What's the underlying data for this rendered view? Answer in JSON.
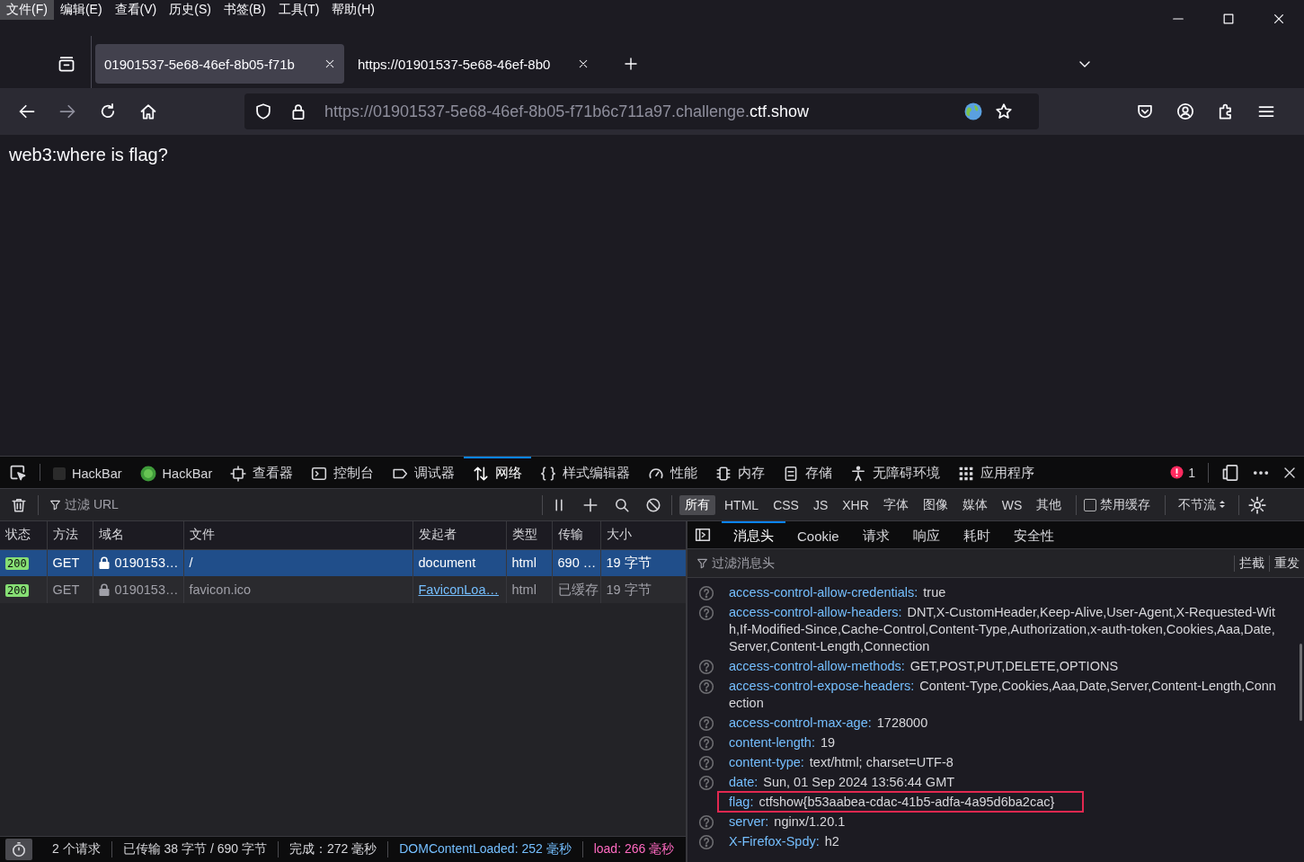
{
  "menu_bar": [
    {
      "label": "文件(F)",
      "selected": true
    },
    {
      "label": "编辑(E)",
      "selected": false
    },
    {
      "label": "查看(V)",
      "selected": false
    },
    {
      "label": "历史(S)",
      "selected": false
    },
    {
      "label": "书签(B)",
      "selected": false
    },
    {
      "label": "工具(T)",
      "selected": false
    },
    {
      "label": "帮助(H)",
      "selected": false
    }
  ],
  "tabs": [
    {
      "title": "01901537-5e68-46ef-8b05-f71b",
      "selected": true
    },
    {
      "title": "https://01901537-5e68-46ef-8b0",
      "selected": false
    }
  ],
  "address_bar": {
    "url_prefix": "https://01901537-5e68-46ef-8b05-f71b6c711a97.challenge.",
    "url_domain": "ctf.show"
  },
  "page": {
    "text": "web3:where is flag?"
  },
  "devtools": {
    "tools": [
      {
        "label": "HackBar",
        "selected": false
      },
      {
        "label": "HackBar",
        "selected": false
      },
      {
        "label": "查看器",
        "selected": false
      },
      {
        "label": "控制台",
        "selected": false
      },
      {
        "label": "调试器",
        "selected": false
      },
      {
        "label": "网络",
        "selected": true
      },
      {
        "label": "样式编辑器",
        "selected": false
      },
      {
        "label": "性能",
        "selected": false
      },
      {
        "label": "内存",
        "selected": false
      },
      {
        "label": "存储",
        "selected": false
      },
      {
        "label": "无障碍环境",
        "selected": false
      },
      {
        "label": "应用程序",
        "selected": false
      }
    ],
    "error_count": "1",
    "filter_placeholder": "过滤 URL",
    "type_filters": [
      {
        "label": "所有",
        "selected": true
      },
      {
        "label": "HTML",
        "selected": false
      },
      {
        "label": "CSS",
        "selected": false
      },
      {
        "label": "JS",
        "selected": false
      },
      {
        "label": "XHR",
        "selected": false
      },
      {
        "label": "字体",
        "selected": false
      },
      {
        "label": "图像",
        "selected": false
      },
      {
        "label": "媒体",
        "selected": false
      },
      {
        "label": "WS",
        "selected": false
      },
      {
        "label": "其他",
        "selected": false
      }
    ],
    "disable_cache": {
      "label": "禁用缓存",
      "checked": false
    },
    "throttle": "不节流",
    "table": {
      "columns": [
        "状态",
        "方法",
        "域名",
        "文件",
        "发起者",
        "类型",
        "传输",
        "大小"
      ],
      "rows": [
        {
          "status": "200",
          "method": "GET",
          "domain": "0190153…",
          "file": "/",
          "initiator": "document",
          "initiator_link": false,
          "type": "html",
          "transferred": "690 …",
          "size": "19 字节",
          "selected": true,
          "cached": false
        },
        {
          "status": "200",
          "method": "GET",
          "domain": "0190153…",
          "file": "favicon.ico",
          "initiator": "FaviconLoa…",
          "initiator_link": true,
          "type": "html",
          "transferred": "已缓存",
          "size": "19 字节",
          "selected": false,
          "cached": true
        }
      ]
    },
    "detail_tabs": [
      {
        "label": "消息头",
        "selected": true
      },
      {
        "label": "Cookie",
        "selected": false
      },
      {
        "label": "请求",
        "selected": false
      },
      {
        "label": "响应",
        "selected": false
      },
      {
        "label": "耗时",
        "selected": false
      },
      {
        "label": "安全性",
        "selected": false
      }
    ],
    "headers_filter_placeholder": "过滤消息头",
    "header_actions": [
      "拦截",
      "重发"
    ],
    "headers": [
      {
        "name": "access-control-allow-credentials:",
        "value": "true",
        "info_icon": true,
        "highlighted": false
      },
      {
        "name": "access-control-allow-headers:",
        "value": "DNT,X-CustomHeader,Keep-Alive,User-Agent,X-Requested-With,If-Modified-Since,Cache-Control,Content-Type,Authorization,x-auth-token,Cookies,Aaa,Date,Server,Content-Length,Connection",
        "info_icon": true,
        "highlighted": false
      },
      {
        "name": "access-control-allow-methods:",
        "value": "GET,POST,PUT,DELETE,OPTIONS",
        "info_icon": true,
        "highlighted": false
      },
      {
        "name": "access-control-expose-headers:",
        "value": "Content-Type,Cookies,Aaa,Date,Server,Content-Length,Connection",
        "info_icon": true,
        "highlighted": false
      },
      {
        "name": "access-control-max-age:",
        "value": "1728000",
        "info_icon": true,
        "highlighted": false
      },
      {
        "name": "content-length:",
        "value": "19",
        "info_icon": true,
        "highlighted": false
      },
      {
        "name": "content-type:",
        "value": "text/html; charset=UTF-8",
        "info_icon": true,
        "highlighted": false
      },
      {
        "name": "date:",
        "value": "Sun, 01 Sep 2024 13:56:44 GMT",
        "info_icon": true,
        "highlighted": false
      },
      {
        "name": "flag:",
        "value": "ctfshow{b53aabea-cdac-41b5-adfa-4a95d6ba2cac}",
        "info_icon": false,
        "highlighted": true
      },
      {
        "name": "server:",
        "value": "nginx/1.20.1",
        "info_icon": true,
        "highlighted": false
      },
      {
        "name": "X-Firefox-Spdy:",
        "value": "h2",
        "info_icon": true,
        "highlighted": false
      }
    ],
    "status_bar": [
      {
        "text": "2 个请求",
        "kind": "plain"
      },
      {
        "text": "已传输 38 字节 / 690 字节",
        "kind": "plain"
      },
      {
        "text": "完成：272 毫秒",
        "kind": "plain"
      },
      {
        "text": "DOMContentLoaded: 252 毫秒",
        "kind": "dom"
      },
      {
        "text": "load: 266 毫秒",
        "kind": "load"
      }
    ]
  }
}
